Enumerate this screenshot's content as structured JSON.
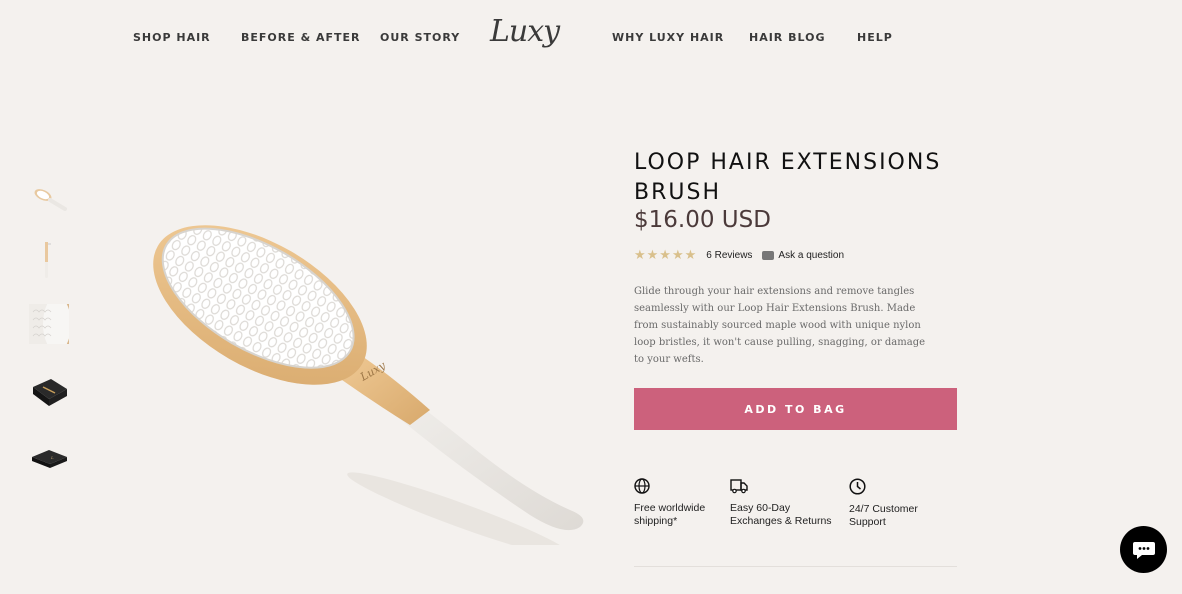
{
  "nav": {
    "left": [
      "SHOP HAIR",
      "BEFORE & AFTER",
      "OUR STORY"
    ],
    "logo": "Luxy",
    "right": [
      "WHY LUXY HAIR",
      "HAIR BLOG",
      "HELP"
    ]
  },
  "product": {
    "title": "LOOP HAIR EXTENSIONS BRUSH",
    "price": "$16.00 USD",
    "stars": "★★★★★",
    "rating": 5,
    "reviews": "6 Reviews",
    "ask": "Ask a question",
    "description": "Glide through your hair extensions and remove tangles seamlessly with our Loop Hair Extensions Brush. Made from sustainably sourced maple wood with unique nylon loop bristles, it won't cause pulling, snagging, or damage to your wefts.",
    "add_to_bag": "ADD TO BAG",
    "logo_on_brush": "Luxy"
  },
  "features": [
    {
      "icon": "globe-icon",
      "text": "Free worldwide\nshipping*"
    },
    {
      "icon": "delivery-truck-icon",
      "text": "Easy 60-Day\nExchanges & Returns"
    },
    {
      "icon": "clock-icon",
      "text": "24/7 Customer\nSupport"
    }
  ],
  "thumbnails": [
    "brush-angle",
    "brush-side",
    "bristles-closeup",
    "box-open",
    "box-closed"
  ],
  "colors": {
    "background": "#f4f1ee",
    "accent": "#cc617c",
    "star": "#d9c08c",
    "price": "#4b3a3a"
  }
}
